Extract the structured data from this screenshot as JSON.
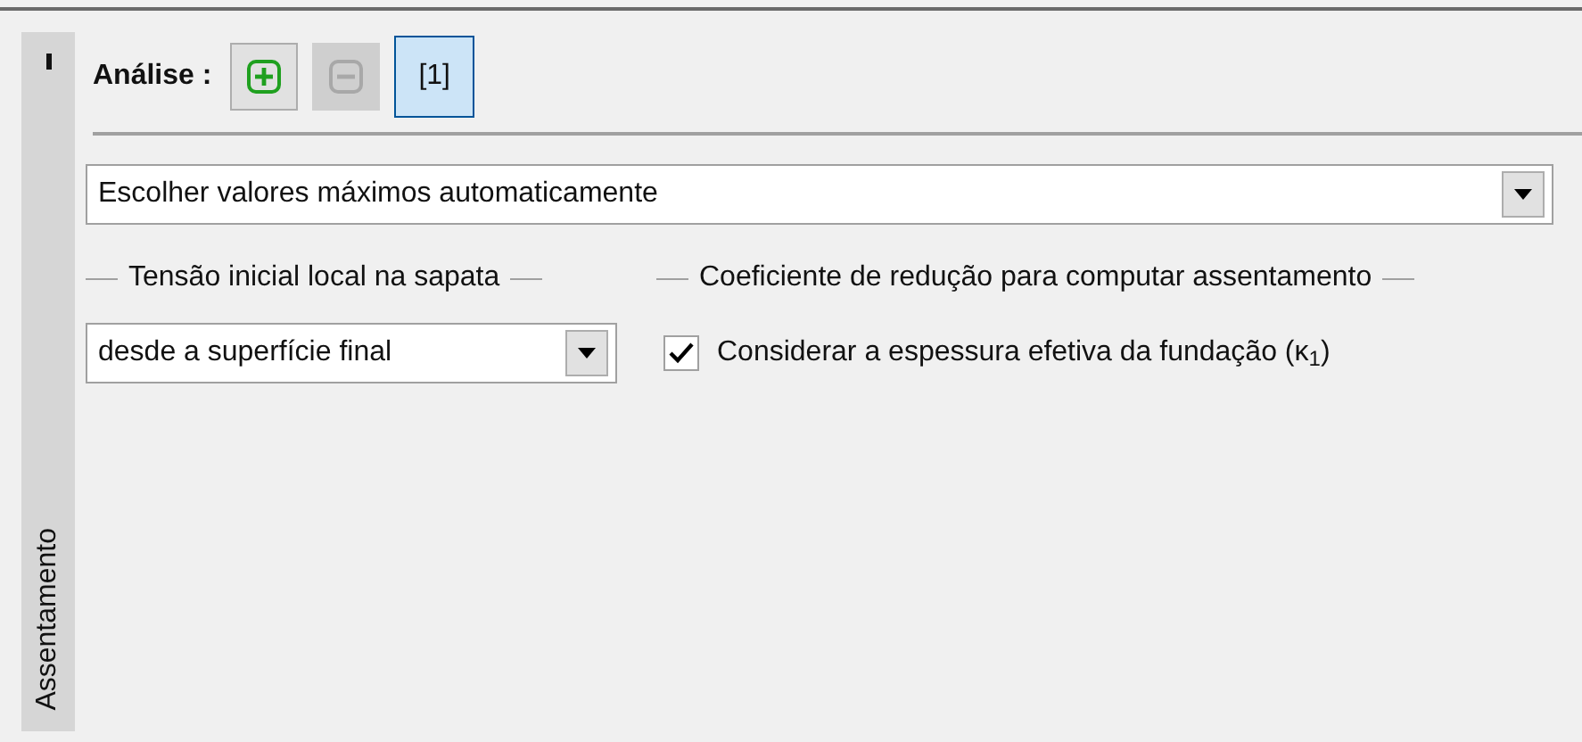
{
  "side_tab": {
    "label": "Assentamento"
  },
  "analysis": {
    "label": "Análise :",
    "add_disabled": false,
    "remove_disabled": true,
    "tabs": [
      {
        "label": "[1]",
        "selected": true
      }
    ]
  },
  "mode_select": {
    "value": "Escolher valores máximos automaticamente"
  },
  "groups": [
    {
      "kind": "select",
      "title": "Tensão inicial local na sapata",
      "value": "desde a superfície final"
    },
    {
      "kind": "checkbox",
      "title": "Coeficiente de redução para computar assentamento",
      "label": "Considerar a espessura efetiva da fundação (κ$_{1}$)",
      "checked": true
    }
  ]
}
